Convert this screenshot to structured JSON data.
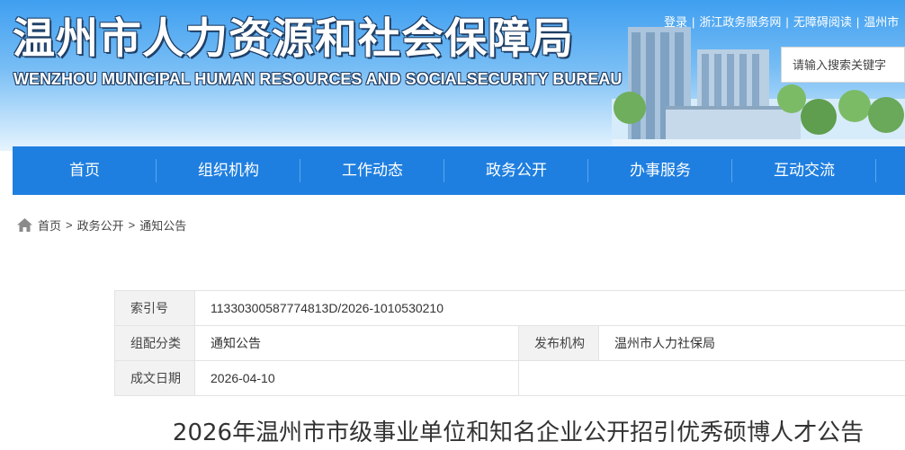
{
  "header": {
    "title_cn": "温州市人力资源和社会保障局",
    "title_en": "WENZHOU MUNICIPAL HUMAN RESOURCES AND SOCIALSECURITY BUREAU",
    "links": [
      "登录",
      "浙江政务服务网",
      "无障碍阅读",
      "温州市"
    ],
    "separator": "|",
    "search_placeholder": "请输入搜索关键字"
  },
  "nav": {
    "items": [
      "首页",
      "组织机构",
      "工作动态",
      "政务公开",
      "办事服务",
      "互动交流"
    ]
  },
  "breadcrumb": {
    "items": [
      "首页",
      "政务公开",
      "通知公告"
    ],
    "separator": ">"
  },
  "meta": {
    "index_label": "索引号",
    "index_value": "11330300587774813D/2026-1010530210",
    "category_label": "组配分类",
    "category_value": "通知公告",
    "publisher_label": "发布机构",
    "publisher_value": "温州市人力社保局",
    "date_label": "成文日期",
    "date_value": "2026-04-10"
  },
  "article": {
    "title": "2026年温州市市级事业单位和知名企业公开招引优秀硕博人才公告"
  },
  "colors": {
    "nav_bg": "#1f7fe0",
    "header_sky": "#3f9ff0",
    "label_bg": "#f2f2f2"
  }
}
